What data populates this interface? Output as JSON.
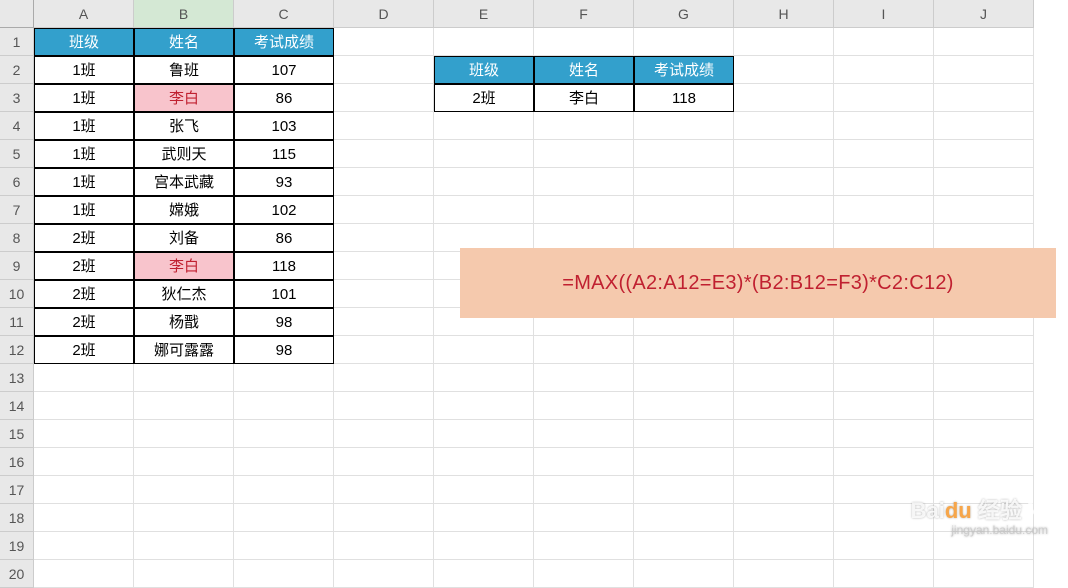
{
  "columns": [
    "A",
    "B",
    "C",
    "D",
    "E",
    "F",
    "G",
    "H",
    "I",
    "J"
  ],
  "selected_column": "B",
  "row_count": 20,
  "main_table": {
    "headers": [
      "班级",
      "姓名",
      "考试成绩"
    ],
    "rows": [
      {
        "class": "1班",
        "name": "鲁班",
        "score": "107",
        "hl": false
      },
      {
        "class": "1班",
        "name": "李白",
        "score": "86",
        "hl": true
      },
      {
        "class": "1班",
        "name": "张飞",
        "score": "103",
        "hl": false
      },
      {
        "class": "1班",
        "name": "武则天",
        "score": "115",
        "hl": false
      },
      {
        "class": "1班",
        "name": "宫本武藏",
        "score": "93",
        "hl": false
      },
      {
        "class": "1班",
        "name": "嫦娥",
        "score": "102",
        "hl": false
      },
      {
        "class": "2班",
        "name": "刘备",
        "score": "86",
        "hl": false
      },
      {
        "class": "2班",
        "name": "李白",
        "score": "118",
        "hl": true
      },
      {
        "class": "2班",
        "name": "狄仁杰",
        "score": "101",
        "hl": false
      },
      {
        "class": "2班",
        "name": "杨戬",
        "score": "98",
        "hl": false
      },
      {
        "class": "2班",
        "name": "娜可露露",
        "score": "98",
        "hl": false
      }
    ]
  },
  "lookup_table": {
    "headers": [
      "班级",
      "姓名",
      "考试成绩"
    ],
    "row": {
      "class": "2班",
      "name": "李白",
      "score": "118"
    }
  },
  "formula": "=MAX((A2:A12=E3)*(B2:B12=F3)*C2:C12)",
  "watermark": {
    "brand_a": "Bai",
    "brand_b": "du",
    "brand_c": "经验",
    "sub": "jingyan.baidu.com"
  }
}
